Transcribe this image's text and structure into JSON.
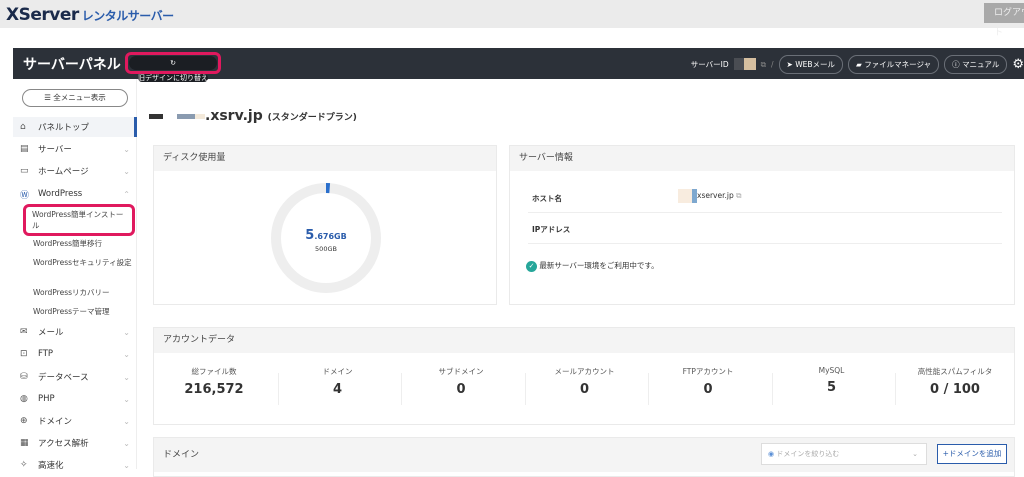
{
  "top": {
    "logo": "XServer",
    "logo_sub": "レンタルサーバー",
    "logout": "ログアウト"
  },
  "header": {
    "title": "サーバーパネル",
    "old_design": "旧デザインに切り替え",
    "server_id_label": "サーバーID",
    "separator": "/",
    "webmail": "WEBメール",
    "file_manager": "ファイルマネージャ",
    "manual": "マニュアル"
  },
  "sidebar": {
    "all_menu": "全メニュー表示",
    "items": [
      {
        "label": "パネルトップ",
        "icon": "home-icon"
      },
      {
        "label": "サーバー",
        "icon": "server-icon"
      },
      {
        "label": "ホームページ",
        "icon": "browser-icon"
      },
      {
        "label": "WordPress",
        "icon": "wordpress-icon"
      },
      {
        "label": "メール",
        "icon": "mail-icon"
      },
      {
        "label": "FTP",
        "icon": "ftp-icon"
      },
      {
        "label": "データベース",
        "icon": "database-icon"
      },
      {
        "label": "PHP",
        "icon": "php-icon"
      },
      {
        "label": "ドメイン",
        "icon": "globe-icon"
      },
      {
        "label": "アクセス解析",
        "icon": "chart-icon"
      },
      {
        "label": "高速化",
        "icon": "speed-icon"
      }
    ],
    "wp_sub": [
      "WordPress簡単インストール",
      "WordPress簡単移行",
      "WordPressセキュリティ設定",
      "WordPressリカバリー",
      "WordPressテーマ管理"
    ]
  },
  "main": {
    "domain": ".xsrv.jp",
    "plan": "(スタンダードプラン)",
    "disk": {
      "title": "ディスク使用量",
      "used_int": "5",
      "used_dec": ".676GB",
      "total": "500GB",
      "fraction": 0.0114
    },
    "server": {
      "title": "サーバー情報",
      "host_label": "ホスト名",
      "host_value": "xserver.jp",
      "ip_label": "IPアドレス",
      "status": "最新サーバー環境をご利用中です。"
    },
    "account": {
      "title": "アカウントデータ",
      "stats": [
        {
          "label": "総ファイル数",
          "value": "216,572"
        },
        {
          "label": "ドメイン",
          "value": "4"
        },
        {
          "label": "サブドメイン",
          "value": "0"
        },
        {
          "label": "メールアカウント",
          "value": "0"
        },
        {
          "label": "FTPアカウント",
          "value": "0"
        },
        {
          "label": "MySQL",
          "value": "5"
        },
        {
          "label": "高性能スパムフィルタ",
          "value": "0 / 100"
        }
      ]
    },
    "domain_card": {
      "title": "ドメイン",
      "filter_placeholder": "ドメインを絞り込む",
      "add": "+ドメインを追加"
    }
  },
  "colors": {
    "accent": "#2a5cab",
    "highlight": "#e0195e",
    "header": "#2c3139"
  }
}
